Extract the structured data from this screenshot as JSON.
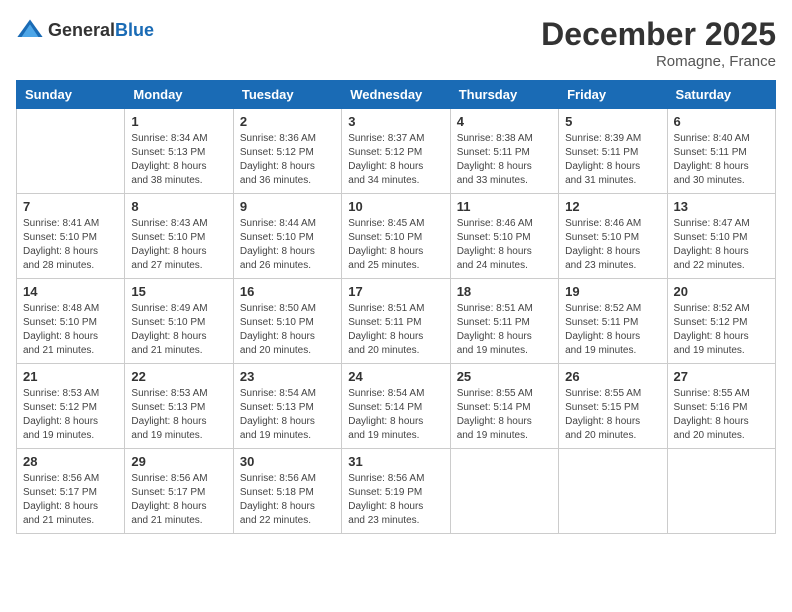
{
  "header": {
    "logo_general": "General",
    "logo_blue": "Blue",
    "month_title": "December 2025",
    "location": "Romagne, France"
  },
  "days_of_week": [
    "Sunday",
    "Monday",
    "Tuesday",
    "Wednesday",
    "Thursday",
    "Friday",
    "Saturday"
  ],
  "weeks": [
    [
      {
        "day": "",
        "info": ""
      },
      {
        "day": "1",
        "info": "Sunrise: 8:34 AM\nSunset: 5:13 PM\nDaylight: 8 hours\nand 38 minutes."
      },
      {
        "day": "2",
        "info": "Sunrise: 8:36 AM\nSunset: 5:12 PM\nDaylight: 8 hours\nand 36 minutes."
      },
      {
        "day": "3",
        "info": "Sunrise: 8:37 AM\nSunset: 5:12 PM\nDaylight: 8 hours\nand 34 minutes."
      },
      {
        "day": "4",
        "info": "Sunrise: 8:38 AM\nSunset: 5:11 PM\nDaylight: 8 hours\nand 33 minutes."
      },
      {
        "day": "5",
        "info": "Sunrise: 8:39 AM\nSunset: 5:11 PM\nDaylight: 8 hours\nand 31 minutes."
      },
      {
        "day": "6",
        "info": "Sunrise: 8:40 AM\nSunset: 5:11 PM\nDaylight: 8 hours\nand 30 minutes."
      }
    ],
    [
      {
        "day": "7",
        "info": "Sunrise: 8:41 AM\nSunset: 5:10 PM\nDaylight: 8 hours\nand 28 minutes."
      },
      {
        "day": "8",
        "info": "Sunrise: 8:43 AM\nSunset: 5:10 PM\nDaylight: 8 hours\nand 27 minutes."
      },
      {
        "day": "9",
        "info": "Sunrise: 8:44 AM\nSunset: 5:10 PM\nDaylight: 8 hours\nand 26 minutes."
      },
      {
        "day": "10",
        "info": "Sunrise: 8:45 AM\nSunset: 5:10 PM\nDaylight: 8 hours\nand 25 minutes."
      },
      {
        "day": "11",
        "info": "Sunrise: 8:46 AM\nSunset: 5:10 PM\nDaylight: 8 hours\nand 24 minutes."
      },
      {
        "day": "12",
        "info": "Sunrise: 8:46 AM\nSunset: 5:10 PM\nDaylight: 8 hours\nand 23 minutes."
      },
      {
        "day": "13",
        "info": "Sunrise: 8:47 AM\nSunset: 5:10 PM\nDaylight: 8 hours\nand 22 minutes."
      }
    ],
    [
      {
        "day": "14",
        "info": "Sunrise: 8:48 AM\nSunset: 5:10 PM\nDaylight: 8 hours\nand 21 minutes."
      },
      {
        "day": "15",
        "info": "Sunrise: 8:49 AM\nSunset: 5:10 PM\nDaylight: 8 hours\nand 21 minutes."
      },
      {
        "day": "16",
        "info": "Sunrise: 8:50 AM\nSunset: 5:10 PM\nDaylight: 8 hours\nand 20 minutes."
      },
      {
        "day": "17",
        "info": "Sunrise: 8:51 AM\nSunset: 5:11 PM\nDaylight: 8 hours\nand 20 minutes."
      },
      {
        "day": "18",
        "info": "Sunrise: 8:51 AM\nSunset: 5:11 PM\nDaylight: 8 hours\nand 19 minutes."
      },
      {
        "day": "19",
        "info": "Sunrise: 8:52 AM\nSunset: 5:11 PM\nDaylight: 8 hours\nand 19 minutes."
      },
      {
        "day": "20",
        "info": "Sunrise: 8:52 AM\nSunset: 5:12 PM\nDaylight: 8 hours\nand 19 minutes."
      }
    ],
    [
      {
        "day": "21",
        "info": "Sunrise: 8:53 AM\nSunset: 5:12 PM\nDaylight: 8 hours\nand 19 minutes."
      },
      {
        "day": "22",
        "info": "Sunrise: 8:53 AM\nSunset: 5:13 PM\nDaylight: 8 hours\nand 19 minutes."
      },
      {
        "day": "23",
        "info": "Sunrise: 8:54 AM\nSunset: 5:13 PM\nDaylight: 8 hours\nand 19 minutes."
      },
      {
        "day": "24",
        "info": "Sunrise: 8:54 AM\nSunset: 5:14 PM\nDaylight: 8 hours\nand 19 minutes."
      },
      {
        "day": "25",
        "info": "Sunrise: 8:55 AM\nSunset: 5:14 PM\nDaylight: 8 hours\nand 19 minutes."
      },
      {
        "day": "26",
        "info": "Sunrise: 8:55 AM\nSunset: 5:15 PM\nDaylight: 8 hours\nand 20 minutes."
      },
      {
        "day": "27",
        "info": "Sunrise: 8:55 AM\nSunset: 5:16 PM\nDaylight: 8 hours\nand 20 minutes."
      }
    ],
    [
      {
        "day": "28",
        "info": "Sunrise: 8:56 AM\nSunset: 5:17 PM\nDaylight: 8 hours\nand 21 minutes."
      },
      {
        "day": "29",
        "info": "Sunrise: 8:56 AM\nSunset: 5:17 PM\nDaylight: 8 hours\nand 21 minutes."
      },
      {
        "day": "30",
        "info": "Sunrise: 8:56 AM\nSunset: 5:18 PM\nDaylight: 8 hours\nand 22 minutes."
      },
      {
        "day": "31",
        "info": "Sunrise: 8:56 AM\nSunset: 5:19 PM\nDaylight: 8 hours\nand 23 minutes."
      },
      {
        "day": "",
        "info": ""
      },
      {
        "day": "",
        "info": ""
      },
      {
        "day": "",
        "info": ""
      }
    ]
  ]
}
